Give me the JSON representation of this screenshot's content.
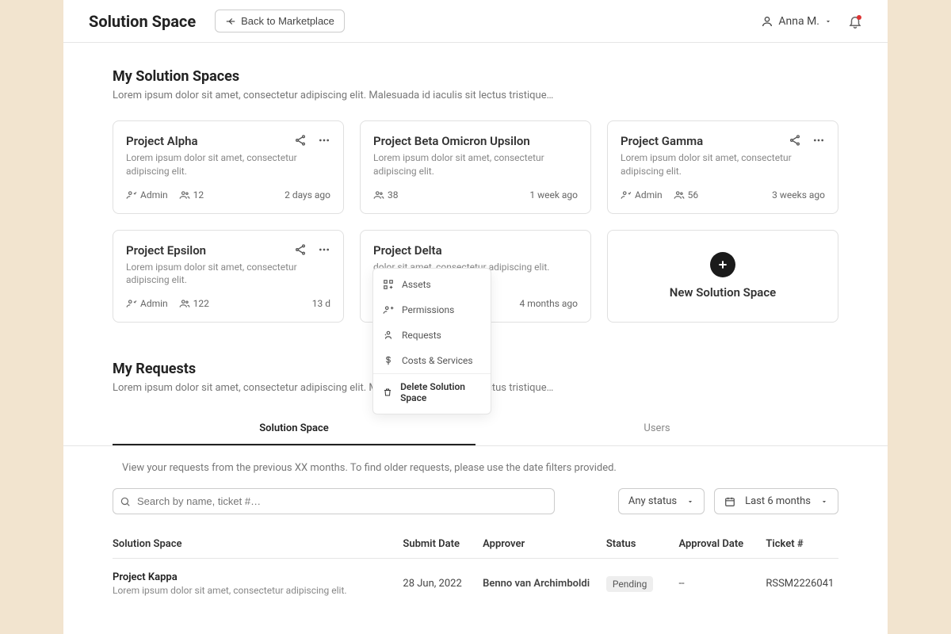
{
  "header": {
    "app_title": "Solution Space",
    "back_label": "Back to Marketplace",
    "user_name": "Anna M."
  },
  "section1": {
    "title": "My Solution Spaces",
    "subtitle": "Lorem ipsum dolor sit amet, consectetur adipiscing elit. Malesuada id iaculis sit lectus tristique…"
  },
  "cards": [
    {
      "title": "Project Alpha",
      "desc": "Lorem ipsum dolor sit amet, consectetur adipiscing elit.",
      "role": "Admin",
      "members": "12",
      "time": "2 days ago",
      "show_actions": true,
      "show_role": true
    },
    {
      "title": "Project Beta Omicron Upsilon",
      "desc": "Lorem ipsum dolor sit amet, consectetur adipiscing elit.",
      "role": "",
      "members": "38",
      "time": "1 week ago",
      "show_actions": false,
      "show_role": false
    },
    {
      "title": "Project Gamma",
      "desc": "Lorem ipsum dolor sit amet, consectetur adipiscing elit.",
      "role": "Admin",
      "members": "56",
      "time": "3 weeks ago",
      "show_actions": true,
      "show_role": true
    },
    {
      "title": "Project Epsilon",
      "desc": "Lorem ipsum dolor sit amet, consectetur adipiscing elit.",
      "role": "Admin",
      "members": "122",
      "time": "13 d",
      "show_actions": true,
      "show_role": true
    },
    {
      "title": "Project Delta",
      "desc": "dolor sit amet, consectetur adipiscing elit.",
      "role": "",
      "members": "",
      "time": "4 months ago",
      "show_actions": false,
      "show_role": false
    }
  ],
  "new_card_label": "New Solution Space",
  "dropdown": {
    "assets": "Assets",
    "permissions": "Permissions",
    "requests": "Requests",
    "costs": "Costs & Services",
    "delete": "Delete Solution Space"
  },
  "section2": {
    "title": "My Requests",
    "subtitle": "Lorem ipsum dolor sit amet, consectetur adipiscing elit. Malesuada id iaculis sit lectus tristique…"
  },
  "tabs": {
    "ss": "Solution Space",
    "users": "Users"
  },
  "requests_hint": "View your requests from the previous XX months. To find older requests, please use the date filters provided.",
  "filters": {
    "search_placeholder": "Search by name, ticket #…",
    "status": "Any status",
    "date": "Last 6 months"
  },
  "table": {
    "cols": {
      "ss": "Solution Space",
      "date": "Submit Date",
      "approver": "Approver",
      "status": "Status",
      "appdate": "Approval Date",
      "ticket": "Ticket #"
    },
    "rows": [
      {
        "title": "Project Kappa",
        "desc": "Lorem ipsum dolor sit amet, consectetur adipiscing elit.",
        "date": "28 Jun, 2022",
        "approver": "Benno van Archimboldi",
        "status": "Pending",
        "appdate": "--",
        "ticket": "RSSM2226041"
      }
    ]
  }
}
